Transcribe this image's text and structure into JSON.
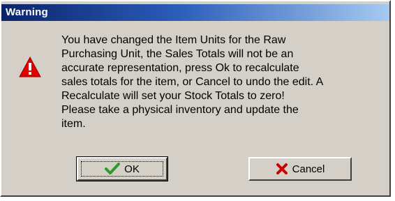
{
  "window": {
    "title": "Warning"
  },
  "icon": {
    "name": "warning-triangle-icon",
    "color": "#e00000"
  },
  "message": {
    "text": "You have changed the Item Units for the Raw\nPurchasing Unit, the Sales Totals will not be an\naccurate representation, press Ok to recalculate\nsales totals for the item, or Cancel to undo the edit.  A\nRecalculate will set your Stock Totals to zero!\nPlease take a physical inventory and update the\nitem."
  },
  "buttons": {
    "ok": {
      "label": "OK",
      "icon": "checkmark-icon",
      "icon_color": "#2e9a2e"
    },
    "cancel": {
      "label": "Cancel",
      "icon": "x-mark-icon",
      "icon_color": "#cc0000"
    }
  },
  "colors": {
    "dialog_bg": "#d4d0c8",
    "titlebar_start": "#0a246a",
    "titlebar_end": "#a6caf0"
  }
}
